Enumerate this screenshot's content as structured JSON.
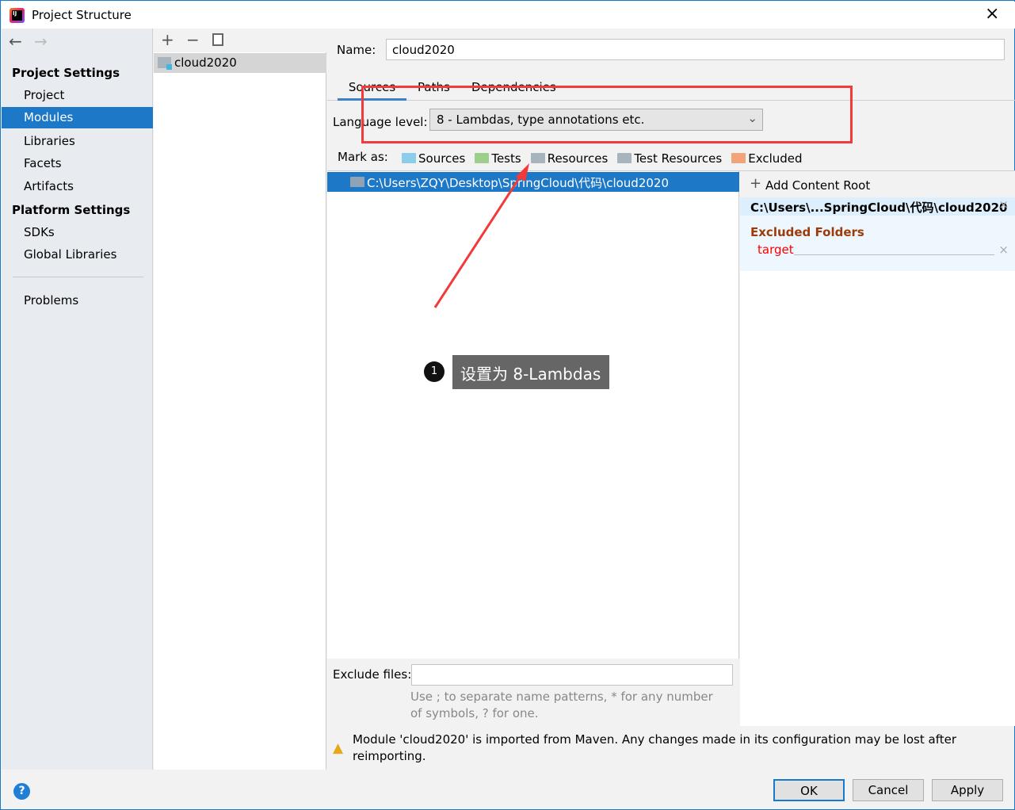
{
  "window": {
    "title": "Project Structure"
  },
  "sidebar": {
    "sections": [
      {
        "label": "Project Settings",
        "items": [
          "Project",
          "Modules",
          "Libraries",
          "Facets",
          "Artifacts"
        ]
      },
      {
        "label": "Platform Settings",
        "items": [
          "SDKs",
          "Global Libraries"
        ]
      }
    ],
    "problems": "Problems",
    "selected": "Modules"
  },
  "modules": {
    "items": [
      "cloud2020"
    ]
  },
  "details": {
    "name_label": "Name:",
    "name_value": "cloud2020",
    "tabs": [
      "Sources",
      "Paths",
      "Dependencies"
    ],
    "active_tab": "Sources",
    "language_label": "Language level:",
    "language_value": "8 - Lambdas, type annotations etc.",
    "mark_as_label": "Mark as:",
    "mark_as": [
      {
        "label": "Sources",
        "color": "#8ccde9"
      },
      {
        "label": "Tests",
        "color": "#9ccf8c"
      },
      {
        "label": "Resources",
        "color": "#a8b4bd"
      },
      {
        "label": "Test Resources",
        "color": "#a8b4bd"
      },
      {
        "label": "Excluded",
        "color": "#f1a37a"
      }
    ],
    "tree_root": "C:\\Users\\ZQY\\Desktop\\SpringCloud\\代码\\cloud2020",
    "add_content_root": "Add Content Root",
    "content_root": "C:\\Users\\...SpringCloud\\代码\\cloud2020",
    "excluded_header": "Excluded Folders",
    "excluded_items": [
      "target"
    ],
    "exclude_files_label": "Exclude files:",
    "exclude_files_value": "",
    "exclude_hint": "Use ; to separate name patterns, * for any number of symbols, ? for one.",
    "warning": "Module 'cloud2020' is imported from Maven. Any changes made in its configuration may be lost after reimporting."
  },
  "annotation": {
    "number": "1",
    "text": "设置为 8-Lambdas",
    "highlight_color": "#f23a3a"
  },
  "footer": {
    "ok": "OK",
    "cancel": "Cancel",
    "apply": "Apply"
  }
}
